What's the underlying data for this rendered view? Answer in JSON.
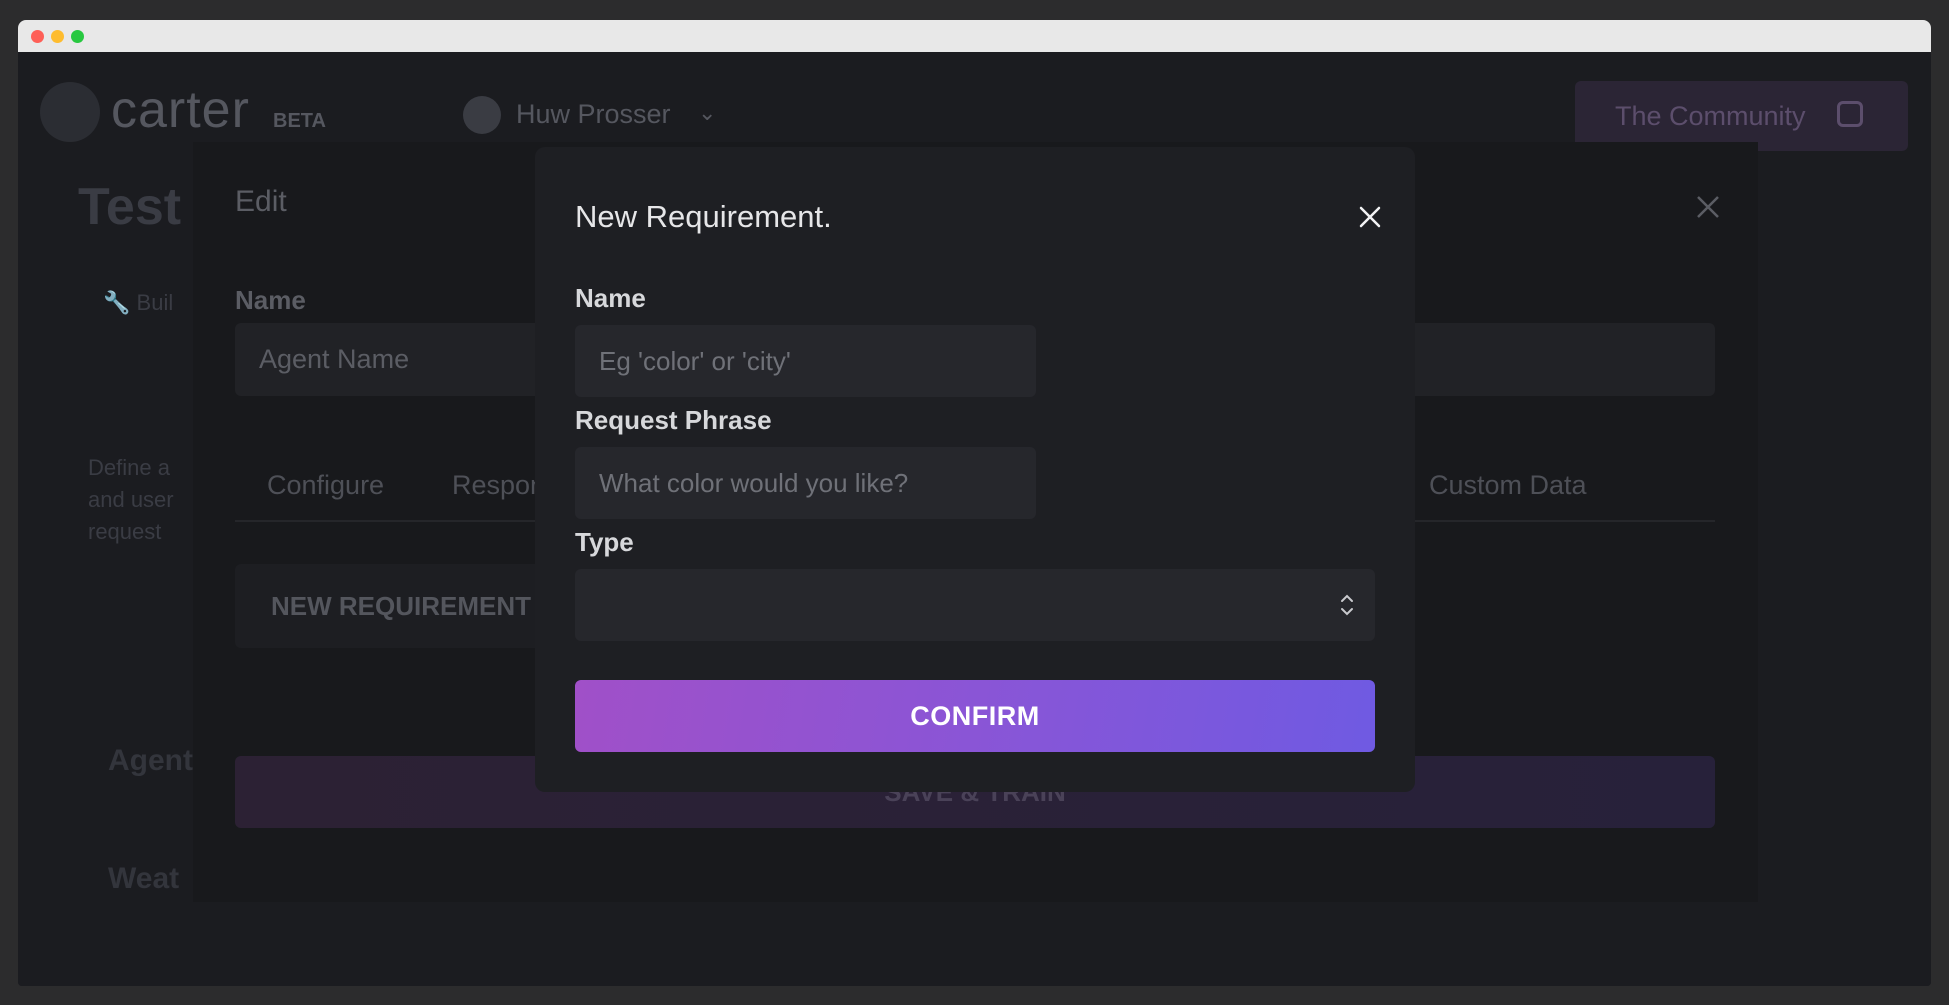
{
  "app": {
    "logo_text": "carter",
    "beta_badge": "BETA",
    "user_name": "Huw Prosser",
    "community_button": "The Community"
  },
  "background_page": {
    "title": "Test I",
    "build_link": "Buil",
    "description": "Define a\nand user\nrequest",
    "section_agents": "Agent",
    "section_weather": "Weat"
  },
  "edit_dialog": {
    "title": "Edit",
    "name_label": "Name",
    "name_placeholder": "Agent Name",
    "tabs": [
      "Configure",
      "Respon",
      "Custom Data"
    ],
    "new_requirement_button": "NEW REQUIREMENT",
    "save_train_button": "SAVE & TRAIN"
  },
  "modal": {
    "title": "New Requirement.",
    "name_label": "Name",
    "name_placeholder": "Eg 'color' or 'city'",
    "name_value": "",
    "phrase_label": "Request Phrase",
    "phrase_placeholder": "What color would you like?",
    "phrase_value": "",
    "type_label": "Type",
    "type_value": "",
    "confirm_button": "CONFIRM"
  },
  "colors": {
    "confirm_gradient_start": "#a050c8",
    "confirm_gradient_end": "#6f5ae2",
    "modal_bg": "#1e1f23"
  }
}
